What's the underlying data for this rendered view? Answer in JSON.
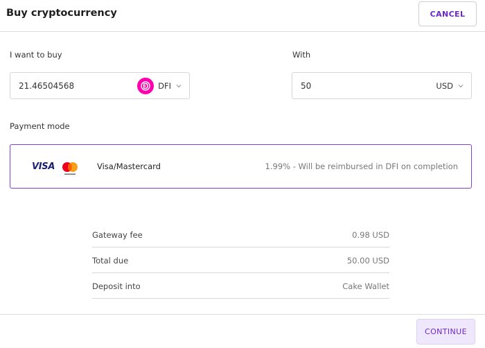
{
  "header": {
    "title": "Buy cryptocurrency",
    "cancel_label": "CANCEL"
  },
  "buy": {
    "label": "I want to buy",
    "amount": "21.46504568",
    "currency": "DFI",
    "currency_icon": "dfi-coin-icon",
    "currency_color": "#ff00af"
  },
  "with": {
    "label": "With",
    "amount": "50",
    "currency": "USD"
  },
  "payment": {
    "label": "Payment mode",
    "visa_text": "VISA",
    "name": "Visa/Mastercard",
    "note": "1.99% - Will be reimbursed in DFI on completion",
    "selected_border_color": "#7b43d1"
  },
  "summary": {
    "rows": [
      {
        "label": "Gateway fee",
        "value": "0.98 USD"
      },
      {
        "label": "Total due",
        "value": "50.00 USD"
      },
      {
        "label": "Deposit into",
        "value": "Cake Wallet"
      }
    ]
  },
  "footer": {
    "continue_label": "CONTINUE"
  },
  "colors": {
    "accent": "#6d28c8",
    "continue_bg": "#efe7fb"
  }
}
